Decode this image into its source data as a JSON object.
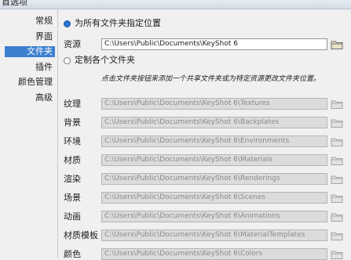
{
  "window": {
    "title": "首选项"
  },
  "sidebar": {
    "items": [
      {
        "label": "常规"
      },
      {
        "label": "界面"
      },
      {
        "label": "文件夹"
      },
      {
        "label": "插件"
      },
      {
        "label": "颜色管理"
      },
      {
        "label": "高级"
      }
    ],
    "selected": "文件夹"
  },
  "folders": {
    "option_all": {
      "label": "为所有文件夹指定位置",
      "checked": true
    },
    "resource": {
      "label": "资源",
      "value": "C:\\Users\\Public\\Documents\\KeyShot 6"
    },
    "option_custom": {
      "label": "定制各个文件夹",
      "checked": false
    },
    "note": "点击文件夹按钮来添加一个共享文件夹或为特定资源更改文件夹位置。",
    "rows": [
      {
        "label": "纹理",
        "value": "C:\\Users\\Public\\Documents\\KeyShot 6\\Textures"
      },
      {
        "label": "背景",
        "value": "C:\\Users\\Public\\Documents\\KeyShot 6\\Backplates"
      },
      {
        "label": "环境",
        "value": "C:\\Users\\Public\\Documents\\KeyShot 6\\Environments"
      },
      {
        "label": "材质",
        "value": "C:\\Users\\Public\\Documents\\KeyShot 6\\Materials"
      },
      {
        "label": "渲染",
        "value": "C:\\Users\\Public\\Documents\\KeyShot 6\\Renderings"
      },
      {
        "label": "场景",
        "value": "C:\\Users\\Public\\Documents\\KeyShot 6\\Scenes"
      },
      {
        "label": "动画",
        "value": "C:\\Users\\Public\\Documents\\KeyShot 6\\Animations"
      },
      {
        "label": "材质模板",
        "value": "C:\\Users\\Public\\Documents\\KeyShot 6\\MaterialTemplates"
      },
      {
        "label": "颜色",
        "value": "C:\\Users\\Public\\Documents\\KeyShot 6\\Colors"
      }
    ]
  },
  "colors": {
    "accent": "#3c7fd0",
    "disabled_field": "#dcdcdc"
  }
}
